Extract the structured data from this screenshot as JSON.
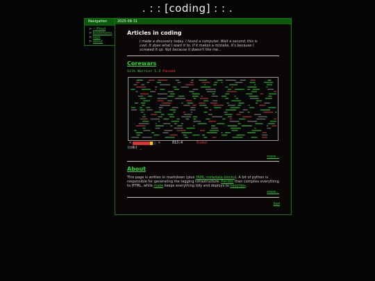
{
  "site": {
    "title": ". : : [coding] : : ."
  },
  "sidebar": {
    "title": "Navigation",
    "items": [
      {
        "prefix": "> ",
        "label": "~/flood"
      },
      {
        "prefix": "> ",
        "label": "bookmarks"
      },
      {
        "prefix": "> ",
        "label": "tags"
      },
      {
        "prefix": "> ",
        "label": "about"
      }
    ]
  },
  "main": {
    "date": "2025-08-31",
    "title": "Articles in coding",
    "intro": "I made a discovery today. I found a computer. Wait a second, this is cool. It does what I want it to. If it makes a mistake, it's because I screwed it up. Not because it doesn't like me...",
    "more_label": "more...",
    "bottom_link": "bad"
  },
  "corewars": {
    "title": "Corewars",
    "warrior_label": "Silk Warrior 1.3",
    "paused_label": "Paused",
    "cycle_value": "013:4",
    "status": "Ended",
    "prompt": "(cdb) _",
    "progress_fraction": 0.75,
    "colors": {
      "green": "#2ad52c",
      "red": "#e03434",
      "yellow": "#e8d020",
      "grey": "#8a8a8a"
    }
  },
  "about": {
    "title": "About",
    "t1": "This page is written in markdown (plus ",
    "link1": "YAML metadata blocks",
    "t2": "). A bit of python is responsible for generating the tagging infrastructure. ",
    "link2": "Pandoc",
    "t3": " then compiles everything to HTML, while ",
    "link3": "make",
    "t4": " keeps everything tidy and deploys to ",
    "link4": "neocities",
    "t5": "."
  }
}
